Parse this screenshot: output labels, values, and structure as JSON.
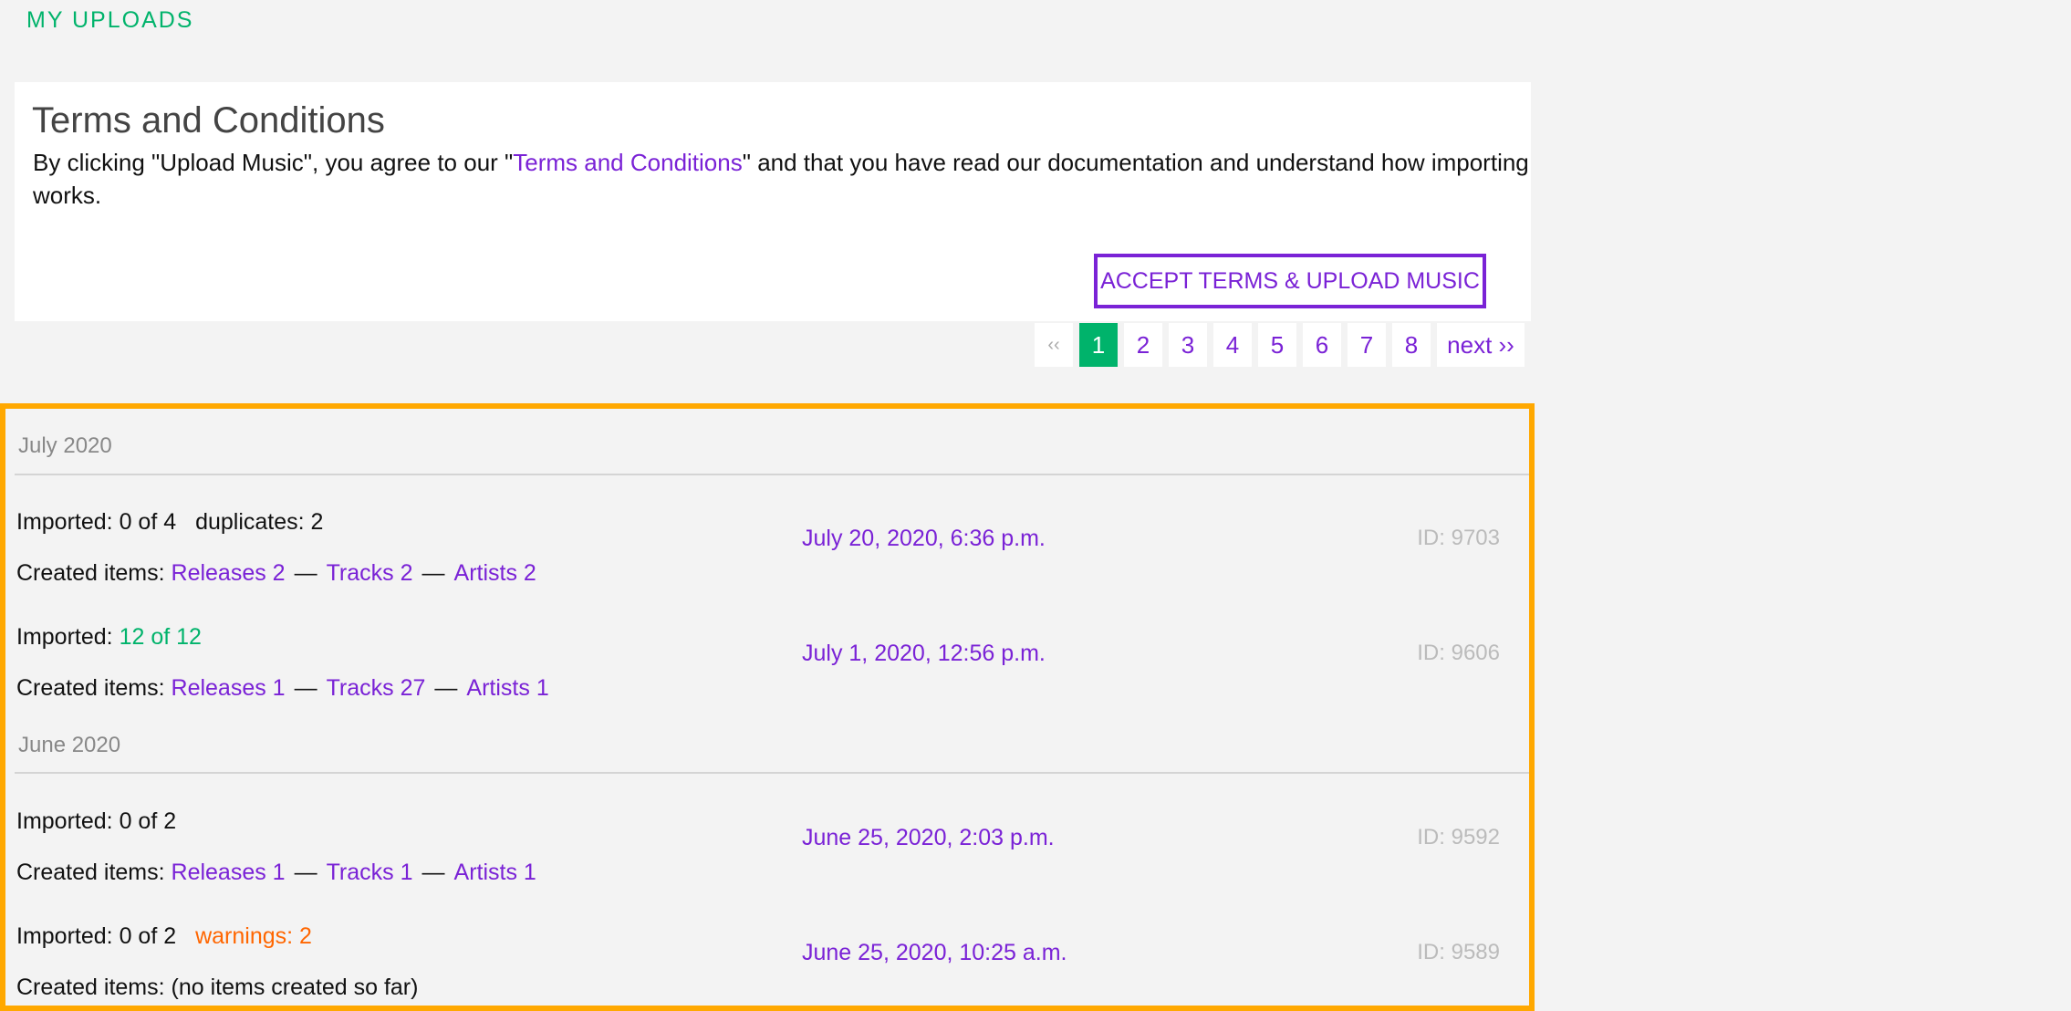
{
  "header": {
    "title": "MY UPLOADS"
  },
  "terms": {
    "title": "Terms and Conditions",
    "text_before": "By clicking \"Upload Music\", you agree to our \"",
    "link_text": "Terms and Conditions",
    "text_after": "\" and that you have read our documentation and understand how importing works.",
    "accept_button": "ACCEPT TERMS & UPLOAD MUSIC"
  },
  "pagination": {
    "prev": "‹‹",
    "pages": [
      "1",
      "2",
      "3",
      "4",
      "5",
      "6",
      "7",
      "8"
    ],
    "active_page": "1",
    "next": "next ››"
  },
  "months": [
    {
      "label": "July 2020"
    },
    {
      "label": "June 2020"
    }
  ],
  "uploads": [
    {
      "imported_label": "Imported:",
      "imported_value": "0 of 4",
      "extra_label": "duplicates: 2",
      "created_label": "Created items:",
      "releases": "Releases 2",
      "tracks": "Tracks 2",
      "artists": "Artists 2",
      "date": "July 20, 2020, 6:36 p.m.",
      "id": "ID: 9703"
    },
    {
      "imported_label": "Imported:",
      "imported_value": "12 of 12",
      "created_label": "Created items:",
      "releases": "Releases 1",
      "tracks": "Tracks 27",
      "artists": "Artists 1",
      "date": "July 1, 2020, 12:56 p.m.",
      "id": "ID: 9606"
    },
    {
      "imported_label": "Imported:",
      "imported_value": "0 of 2",
      "created_label": "Created items:",
      "releases": "Releases 1",
      "tracks": "Tracks 1",
      "artists": "Artists 1",
      "date": "June 25, 2020, 2:03 p.m.",
      "id": "ID: 9592"
    },
    {
      "imported_label": "Imported:",
      "imported_value": "0 of 2",
      "warning_label": "warnings: 2",
      "created_label": "Created items:",
      "created_none": "(no items created so far)",
      "date": "June 25, 2020, 10:25 a.m.",
      "id": "ID: 9589"
    }
  ],
  "colors": {
    "accent": "#7a22d6",
    "success": "#00b36b",
    "warning": "#ff6600",
    "highlight_border": "#ffa800"
  },
  "dash": "—"
}
